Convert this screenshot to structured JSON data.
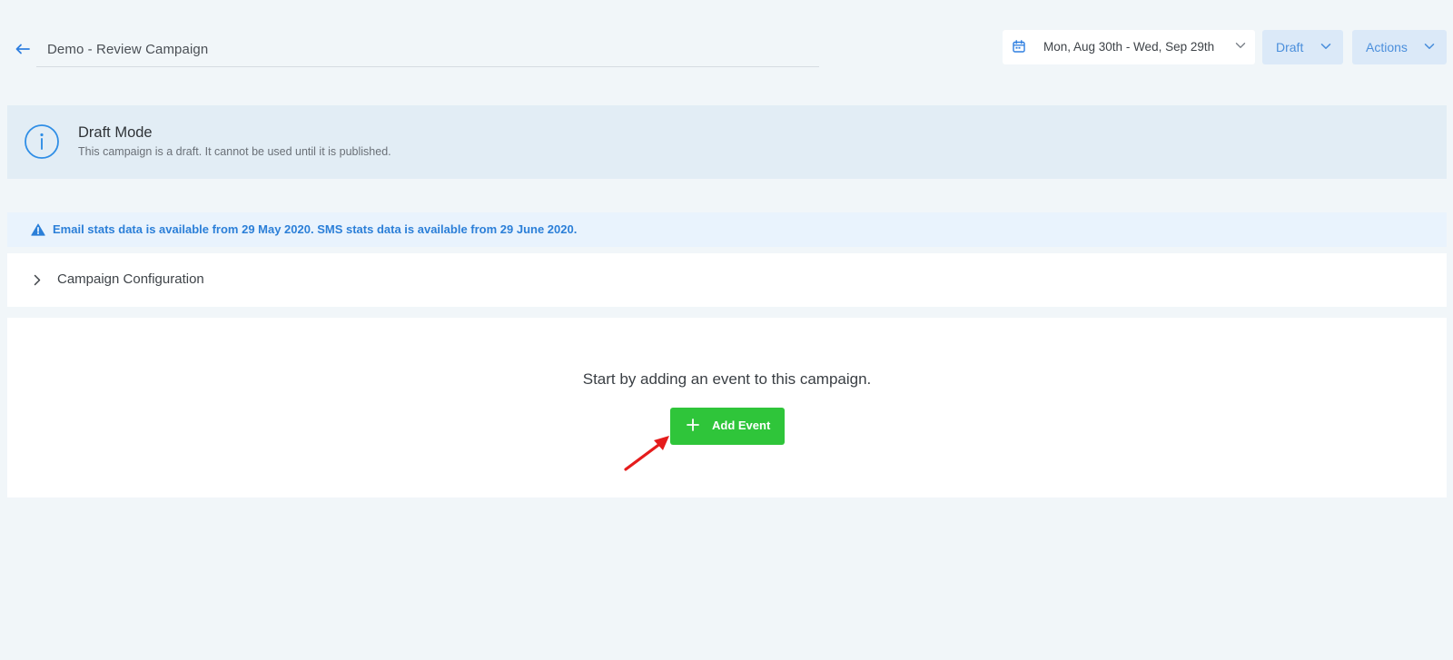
{
  "header": {
    "back_icon": "arrow-left-icon",
    "campaign_title": "Demo - Review Campaign",
    "date_range": {
      "icon": "calendar-icon",
      "text": "Mon, Aug 30th - Wed, Sep 29th"
    },
    "status_dropdown": {
      "label": "Draft"
    },
    "actions_dropdown": {
      "label": "Actions"
    }
  },
  "draft_banner": {
    "icon": "info-icon",
    "title": "Draft Mode",
    "message": "This campaign is a draft. It cannot be used until it is published."
  },
  "stats_alert": {
    "icon": "warning-icon",
    "message": "Email stats data is available from 29 May 2020. SMS stats data is available from 29 June 2020."
  },
  "configuration": {
    "label": "Campaign Configuration",
    "expanded": false
  },
  "empty_state": {
    "message": "Start by adding an event to this campaign.",
    "add_button_label": "Add Event"
  },
  "colors": {
    "background": "#f1f6f9",
    "accent_blue": "#4b8fdc",
    "dropdown_bg": "#dbe9f8",
    "banner_bg": "#e2edf5",
    "alert_bg": "#e9f3fd",
    "alert_text": "#2b7fd8",
    "add_button": "#2fc53a",
    "annotation_arrow": "#e51c1c"
  }
}
